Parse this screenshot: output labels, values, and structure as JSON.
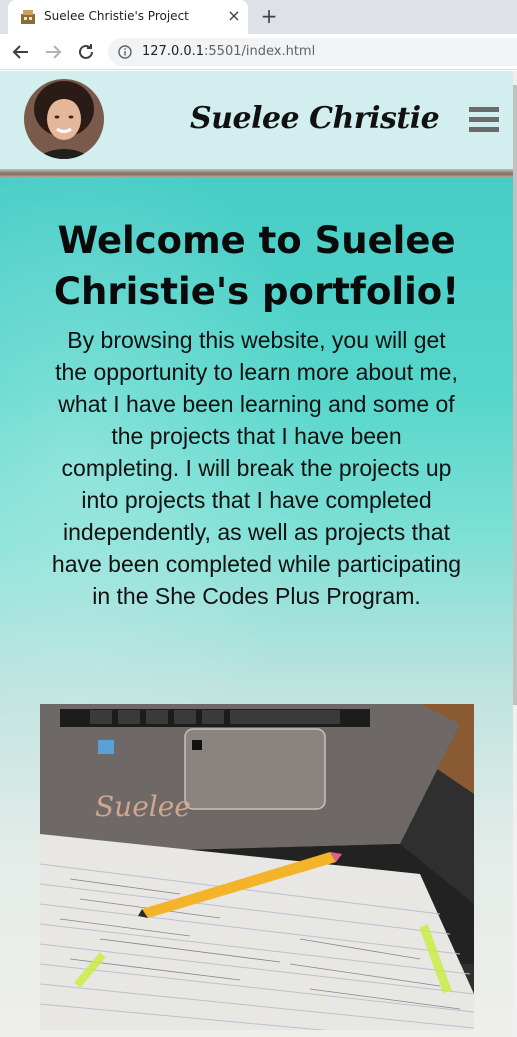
{
  "browser": {
    "tab_title": "Suelee Christie's Project",
    "close_label": "×",
    "newtab_label": "+",
    "url_host": "127.0.0.1",
    "url_path": ":5501/index.html"
  },
  "header": {
    "brand": "Suelee Christie",
    "avatar": "portrait-photo",
    "menu_icon": "hamburger-icon"
  },
  "main": {
    "title": "Welcome to Suelee Christie's portfolio!",
    "intro": "By browsing this website, you will get the opportunity to learn more about me, what I have been learning and some of the projects that I have been completing. I will break the projects up into projects that I have completed independently, as well as projects that have been completed while participating in the She Codes Plus Program.",
    "image_laptop_text": "Suelee"
  },
  "colors": {
    "header_bg": "#d2eeee",
    "teal": "#3fc8c4",
    "text": "#0a0a0a"
  }
}
